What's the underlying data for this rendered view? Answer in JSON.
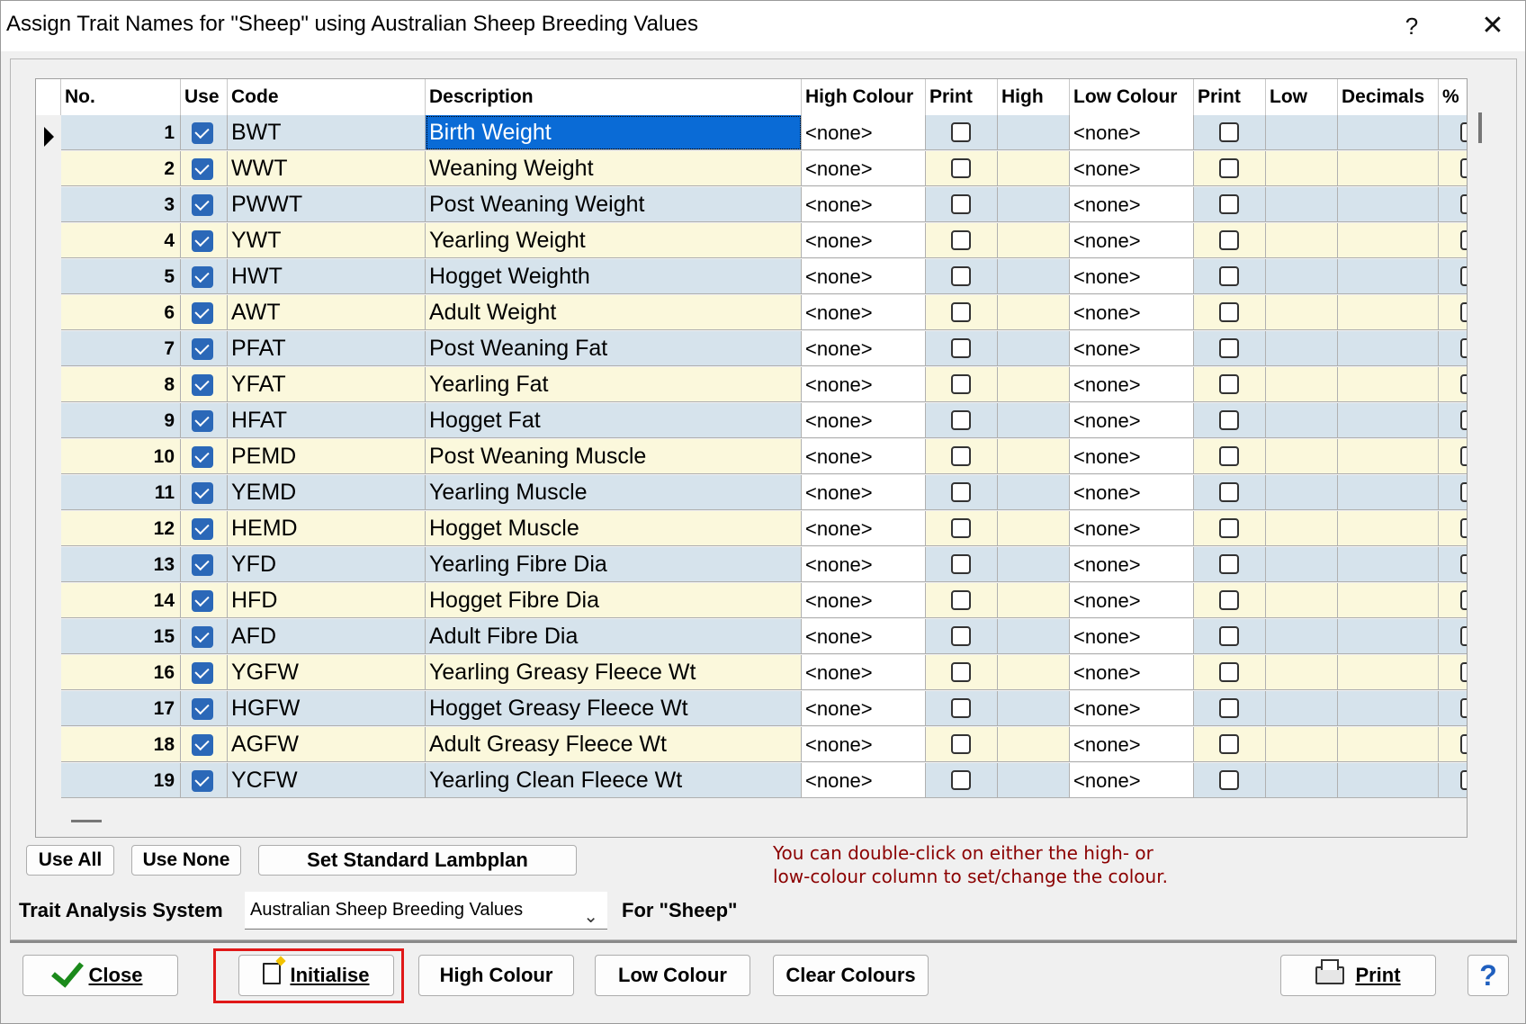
{
  "window": {
    "title": "Assign Trait Names for \"Sheep\" using Australian Sheep Breeding Values",
    "help_glyph": "?",
    "close_glyph": "✕"
  },
  "grid": {
    "columns": [
      "No.",
      "Use",
      "Code",
      "Description",
      "High Colour",
      "Print",
      "High",
      "Low Colour",
      "Print",
      "Low",
      "Decimals",
      "%"
    ],
    "rows": [
      {
        "no": "1",
        "code": "BWT",
        "description": "Birth Weight",
        "high_colour": "<none>",
        "low_colour": "<none>"
      },
      {
        "no": "2",
        "code": "WWT",
        "description": "Weaning Weight",
        "high_colour": "<none>",
        "low_colour": "<none>"
      },
      {
        "no": "3",
        "code": "PWWT",
        "description": "Post Weaning Weight",
        "high_colour": "<none>",
        "low_colour": "<none>"
      },
      {
        "no": "4",
        "code": "YWT",
        "description": "Yearling Weight",
        "high_colour": "<none>",
        "low_colour": "<none>"
      },
      {
        "no": "5",
        "code": "HWT",
        "description": "Hogget Weighth",
        "high_colour": "<none>",
        "low_colour": "<none>"
      },
      {
        "no": "6",
        "code": "AWT",
        "description": "Adult Weight",
        "high_colour": "<none>",
        "low_colour": "<none>"
      },
      {
        "no": "7",
        "code": "PFAT",
        "description": "Post Weaning Fat",
        "high_colour": "<none>",
        "low_colour": "<none>"
      },
      {
        "no": "8",
        "code": "YFAT",
        "description": "Yearling Fat",
        "high_colour": "<none>",
        "low_colour": "<none>"
      },
      {
        "no": "9",
        "code": "HFAT",
        "description": "Hogget Fat",
        "high_colour": "<none>",
        "low_colour": "<none>"
      },
      {
        "no": "10",
        "code": "PEMD",
        "description": "Post Weaning Muscle",
        "high_colour": "<none>",
        "low_colour": "<none>"
      },
      {
        "no": "11",
        "code": "YEMD",
        "description": "Yearling Muscle",
        "high_colour": "<none>",
        "low_colour": "<none>"
      },
      {
        "no": "12",
        "code": "HEMD",
        "description": "Hogget Muscle",
        "high_colour": "<none>",
        "low_colour": "<none>"
      },
      {
        "no": "13",
        "code": "YFD",
        "description": "Yearling Fibre Dia",
        "high_colour": "<none>",
        "low_colour": "<none>"
      },
      {
        "no": "14",
        "code": "HFD",
        "description": "Hogget Fibre Dia",
        "high_colour": "<none>",
        "low_colour": "<none>"
      },
      {
        "no": "15",
        "code": "AFD",
        "description": "Adult Fibre Dia",
        "high_colour": "<none>",
        "low_colour": "<none>"
      },
      {
        "no": "16",
        "code": "YGFW",
        "description": "Yearling Greasy Fleece Wt",
        "high_colour": "<none>",
        "low_colour": "<none>"
      },
      {
        "no": "17",
        "code": "HGFW",
        "description": "Hogget Greasy Fleece Wt",
        "high_colour": "<none>",
        "low_colour": "<none>"
      },
      {
        "no": "18",
        "code": "AGFW",
        "description": "Adult Greasy Fleece Wt",
        "high_colour": "<none>",
        "low_colour": "<none>"
      },
      {
        "no": "19",
        "code": "YCFW",
        "description": "Yearling Clean Fleece Wt",
        "high_colour": "<none>",
        "low_colour": "<none>"
      }
    ],
    "selected_row": 1
  },
  "buttons": {
    "use_all": "Use All",
    "use_none": "Use None",
    "set_standard": "Set Standard Lambplan",
    "close": "Close",
    "initialise": "Initialise",
    "high_colour": "High Colour",
    "low_colour": "Low Colour",
    "clear_colours": "Clear Colours",
    "print": "Print",
    "help_glyph": "?"
  },
  "hint": {
    "line1": "You can double-click on either the high- or",
    "line2": "low-colour column to set/change the colour."
  },
  "trait_analysis": {
    "label": "Trait Analysis System",
    "selected": "Australian Sheep Breeding Values",
    "for_label": "For \"Sheep\""
  },
  "colors": {
    "row_odd": "#d6e3ec",
    "row_even": "#fbf8dc",
    "selection": "#0a6bd6",
    "checkbox_on": "#2b68b8",
    "hint_text": "#8b0000",
    "highlight_box": "#e01818"
  },
  "icons": {
    "close_button": "green-check-icon",
    "initialise_button": "new-document-icon",
    "print_button": "printer-icon",
    "help_button": "help-question-icon"
  }
}
